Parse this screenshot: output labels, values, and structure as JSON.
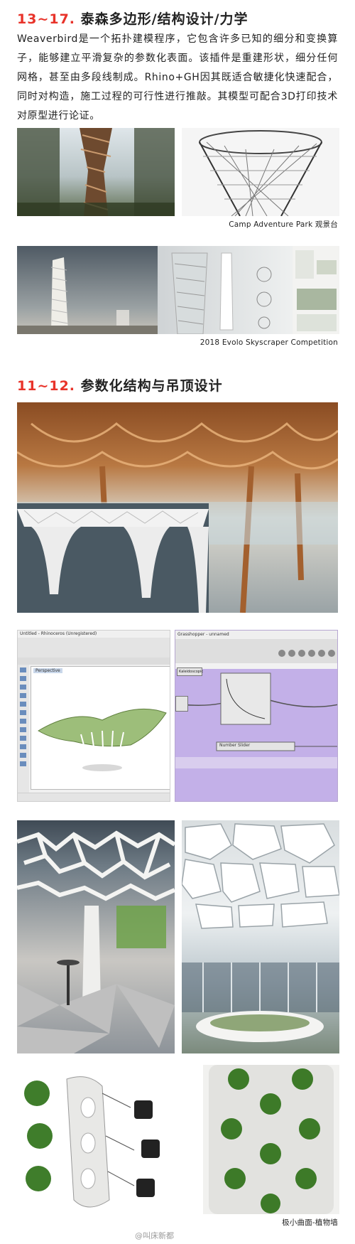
{
  "section1": {
    "heading_num": "13~17.",
    "heading_text": "泰森多边形/结构设计/力学",
    "paragraph": "Weaverbird是一个拓扑建模程序，它包含许多已知的细分和变换算子，能够建立平滑复杂的参数化表面。该插件是重建形状，细分任何网格，甚至由多段线制成。Rhino+GH因其既适合敏捷化快速配合，同时对构造，施工过程的可行性进行推敲。其模型可配合3D打印技术对原型进行论证。",
    "caption1": "Camp Adventure Park 观景台",
    "caption2": "2018 Evolo Skyscraper Competition"
  },
  "section2": {
    "heading_num": "11~12.",
    "heading_text": "参数化结构与吊顶设计",
    "software": {
      "rhino_title": "Untitled - Rhinoceros (Unregistered)",
      "gh_title": "Grasshopper - unnamed",
      "slider_label": "Number Slider",
      "viewport_label": "Perspective",
      "component_label": "Kaleidoscopic"
    },
    "caption3": "极小曲面-植物墙"
  },
  "watermark": "@叫床新都"
}
